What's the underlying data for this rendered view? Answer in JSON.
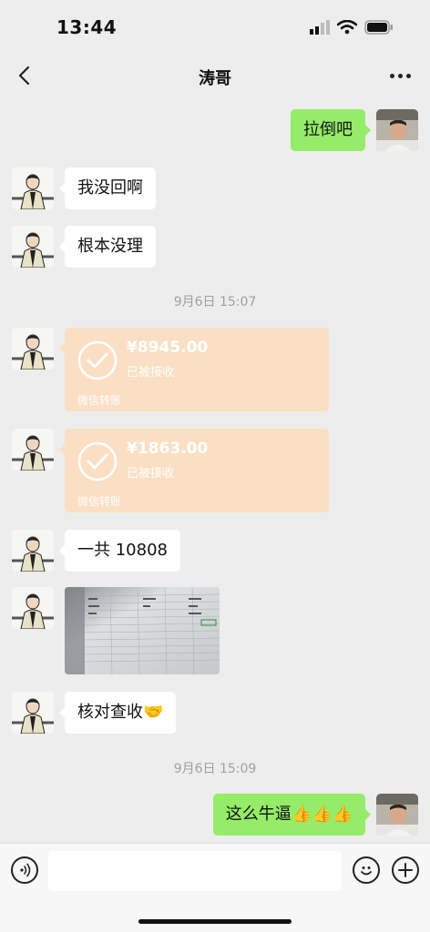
{
  "status_bar": {
    "time": "13:44"
  },
  "header": {
    "title": "涛哥"
  },
  "messages": {
    "m1": "拉倒吧",
    "m2": "我没回啊",
    "m3": "根本没理",
    "m4": "一共 10808",
    "m5": "核对查收🤝",
    "m6": "这么牛逼👍👍👍"
  },
  "timestamps": {
    "t1": "9月6日 15:07",
    "t2": "9月6日 15:09"
  },
  "transfers": [
    {
      "amount": "¥8945.00",
      "status": "已被接收",
      "footer": "微信转账"
    },
    {
      "amount": "¥1863.00",
      "status": "已被接收",
      "footer": "微信转账"
    }
  ],
  "colors": {
    "background": "#ededed",
    "my_bubble": "#95ec69",
    "their_bubble": "#ffffff",
    "transfer_card": "#fbdfc4"
  }
}
